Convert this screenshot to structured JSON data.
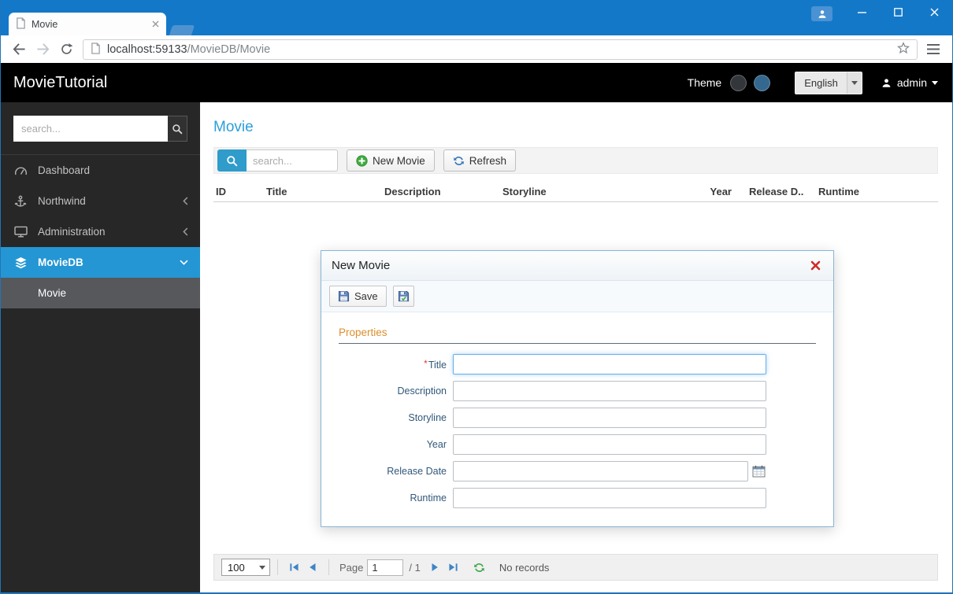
{
  "colors": {
    "titlebar_blue": "#1478c8",
    "accent_blue": "#2b9fd9",
    "active_nav_blue": "#2496d3",
    "category_orange": "#dd8f2d",
    "theme_swatch_dark": "#33373b",
    "theme_swatch_blue": "#35688e"
  },
  "icons": {
    "search-icon": "magnifier",
    "new-icon": "green-plus-circle",
    "refresh-icon": "blue-circular-arrows",
    "pager-refresh-icon": "green-circular-arrows",
    "save-icon": "floppy-disk",
    "apply-changes-icon": "floppy-disk-check",
    "calendar-icon": "calendar-grid",
    "dialog-close-icon": "red-x",
    "dashboard-icon": "gauge",
    "northwind-icon": "anchor",
    "administration-icon": "monitor",
    "moviedb-icon": "layers",
    "user-icon": "person"
  },
  "browser": {
    "tab_title": "Movie",
    "url_host": "localhost:59133",
    "url_path": "/MovieDB/Movie"
  },
  "app_header": {
    "brand": "MovieTutorial",
    "theme_label": "Theme",
    "language_button": "English",
    "user_name": "admin"
  },
  "sidebar": {
    "search_placeholder": "search...",
    "items": [
      {
        "label": "Dashboard"
      },
      {
        "label": "Northwind"
      },
      {
        "label": "Administration"
      },
      {
        "label": "MovieDB"
      },
      {
        "label": "Movie"
      }
    ]
  },
  "main": {
    "page_title": "Movie",
    "toolbar": {
      "search_placeholder": "search...",
      "new_button_label": "New Movie",
      "refresh_button_label": "Refresh"
    },
    "grid": {
      "columns": [
        "ID",
        "Title",
        "Description",
        "Storyline",
        "Year",
        "Release D...",
        "Runtime"
      ]
    },
    "pager": {
      "page_size": "100",
      "page_label": "Page",
      "page_number": "1",
      "page_count": "/ 1",
      "status": "No records"
    }
  },
  "dialog": {
    "title": "New Movie",
    "save_button_label": "Save",
    "category_title": "Properties",
    "required_marker": "*",
    "fields": [
      {
        "label": "Title"
      },
      {
        "label": "Description"
      },
      {
        "label": "Storyline"
      },
      {
        "label": "Year"
      },
      {
        "label": "Release Date"
      },
      {
        "label": "Runtime"
      }
    ]
  }
}
